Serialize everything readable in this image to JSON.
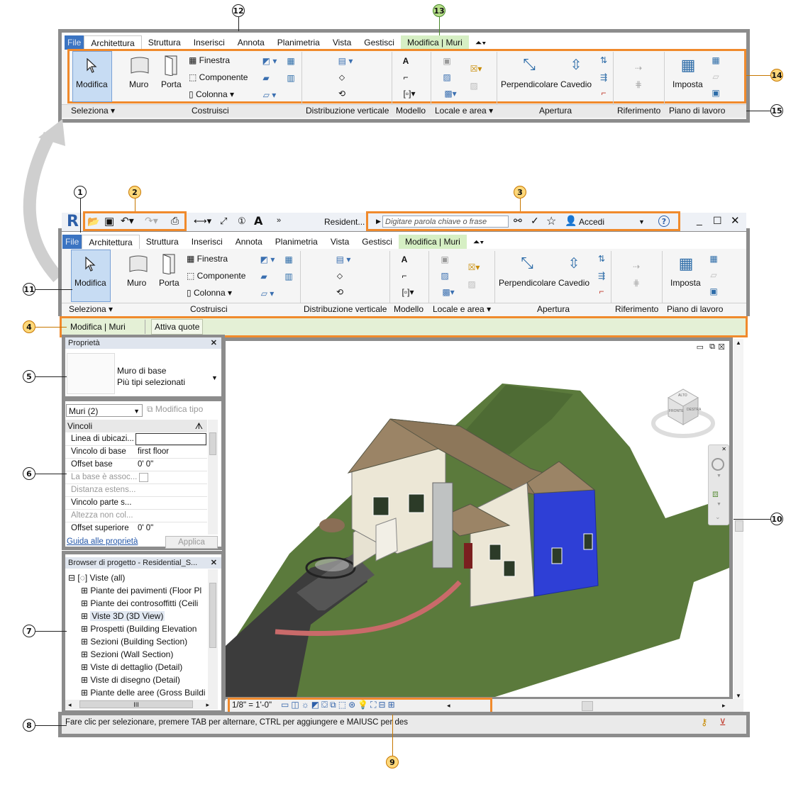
{
  "callouts": [
    "1",
    "2",
    "3",
    "4",
    "5",
    "6",
    "7",
    "8",
    "9",
    "10",
    "11",
    "12",
    "13",
    "14",
    "15"
  ],
  "top_ribbon": {
    "file_tab": "File",
    "tabs": [
      "Architettura",
      "Struttura",
      "Inserisci",
      "Annota",
      "Planimetria",
      "Vista",
      "Gestisci"
    ],
    "context_tab": "Modifica | Muri",
    "buttons": {
      "modifica": "Modifica",
      "muro": "Muro",
      "porta": "Porta",
      "finestra": "Finestra",
      "componente": "Componente",
      "colonna": "Colonna",
      "perpendicolare": "Perpendicolare",
      "cavedio": "Cavedio",
      "imposta": "Imposta"
    },
    "groups": [
      "Seleziona",
      "Costruisci",
      "Distribuzione verticale",
      "Modello",
      "Locale e area",
      "Apertura",
      "Riferimento",
      "Piano di lavoro"
    ]
  },
  "app": {
    "logo": "R",
    "title_text": "Resident...",
    "search_placeholder": "Digitare parola chiave o frase",
    "signin": "Accedi",
    "help": "?"
  },
  "options_bar": {
    "mode": "Modifica | Muri",
    "button": "Attiva quote"
  },
  "properties": {
    "title": "Proprietà",
    "type_name": "Muro di base",
    "type_sub": "Più tipi selezionati",
    "filter": "Muri (2)",
    "edit_type": "Modifica tipo",
    "section": "Vincoli",
    "rows": [
      {
        "name": "Linea di ubicazi...",
        "value": ""
      },
      {
        "name": "Vincolo di base",
        "value": "first floor"
      },
      {
        "name": "Offset base",
        "value": "0'  0\""
      },
      {
        "name": "La base è assoc...",
        "value": ""
      },
      {
        "name": "Distanza estens...",
        "value": ""
      },
      {
        "name": "Vincolo parte s...",
        "value": ""
      },
      {
        "name": "Altezza non col...",
        "value": ""
      },
      {
        "name": "Offset superiore",
        "value": "0'  0\""
      }
    ],
    "help_link": "Guida alle proprietà",
    "apply": "Applica"
  },
  "browser": {
    "title": "Browser di progetto - Residential_S...",
    "root": "Viste (all)",
    "items": [
      "Piante dei pavimenti (Floor Pl",
      "Piante dei controsoffitti (Ceili",
      "Viste 3D (3D View)",
      "Prospetti (Building Elevation",
      "Sezioni (Building Section)",
      "Sezioni (Wall Section)",
      "Viste di dettaglio (Detail)",
      "Viste di disegno (Detail)",
      "Piante delle aree (Gross Buildi"
    ],
    "scroll_marker": "III"
  },
  "viewcube": {
    "front": "FRONTE",
    "right": "DESTRA",
    "top": "ALTO"
  },
  "view_control_bar": {
    "scale": "1/8\" = 1'-0\""
  },
  "status_bar": {
    "text": "Fare clic per selezionare, premere TAB per alternare, CTRL per aggiungere e MAIUSC per des"
  },
  "colors": {
    "accent_orange": "#f08a2c",
    "frame_gray": "#8c8c8c",
    "selection_blue": "#2e3fd6",
    "terrain_green": "#5b7a3c",
    "roof_brown": "#9b8466"
  }
}
